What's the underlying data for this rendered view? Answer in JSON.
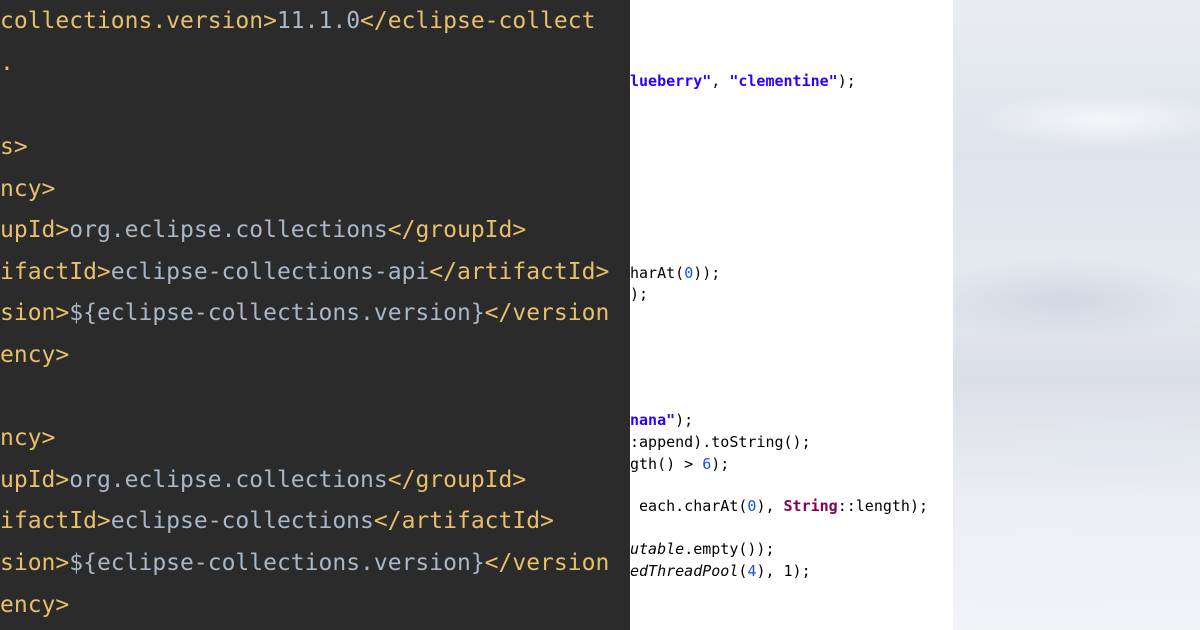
{
  "dark_code": {
    "line1": {
      "tag_open": "collections.version>",
      "text": "11.1.0",
      "tag_close": "</eclipse-collect"
    },
    "line2": {
      "tag": "."
    },
    "line3": {
      "tag": "s>"
    },
    "line4": {
      "tag": "ncy>"
    },
    "line5": {
      "tag_open": "upId>",
      "text": "org.eclipse.collections",
      "tag_close": "</groupId>"
    },
    "line6": {
      "tag_open": "ifactId>",
      "text": "eclipse-collections-api",
      "tag_close": "</artifactId>"
    },
    "line7": {
      "tag_open": "sion>",
      "text": "${eclipse-collections.version}",
      "tag_close": "</version"
    },
    "line8": {
      "tag": "ency>"
    },
    "line9": {
      "tag": "ncy>"
    },
    "line10": {
      "tag_open": "upId>",
      "text": "org.eclipse.collections",
      "tag_close": "</groupId>"
    },
    "line11": {
      "tag_open": "ifactId>",
      "text": "eclipse-collections",
      "tag_close": "</artifactId>"
    },
    "line12": {
      "tag_open": "sion>",
      "text": "${eclipse-collections.version}",
      "tag_close": "</version"
    },
    "line13": {
      "tag": "ency>"
    }
  },
  "light_code": {
    "l1_str1": "lueberry\"",
    "l1_mid": ", ",
    "l1_str2": "\"clementine\"",
    "l1_end": ");",
    "l2_pre": "harAt(",
    "l2_num": "0",
    "l2_end": "));",
    "l3": ");",
    "l4_str": "nana\"",
    "l4_end": ");",
    "l5": ":append).toString();",
    "l6_pre": "gth() > ",
    "l6_num": "6",
    "l6_end": ");",
    "l7_pre": " each.charAt(",
    "l7_num": "0",
    "l7_mid": "), ",
    "l7_kw": "String",
    "l7_end": "::length);",
    "l8_ital": "utable",
    "l8_end": ".empty());",
    "l9_ital": "edThreadPool",
    "l9_mid": "(",
    "l9_num": "4",
    "l9_end": "), 1);"
  },
  "colors": {
    "dark_bg": "#2b2b2b",
    "xml_tag": "#e8bf6a",
    "xml_text": "#a9b7c6",
    "string": "#2a00ff",
    "keyword": "#7f0055",
    "number": "#1750eb"
  }
}
